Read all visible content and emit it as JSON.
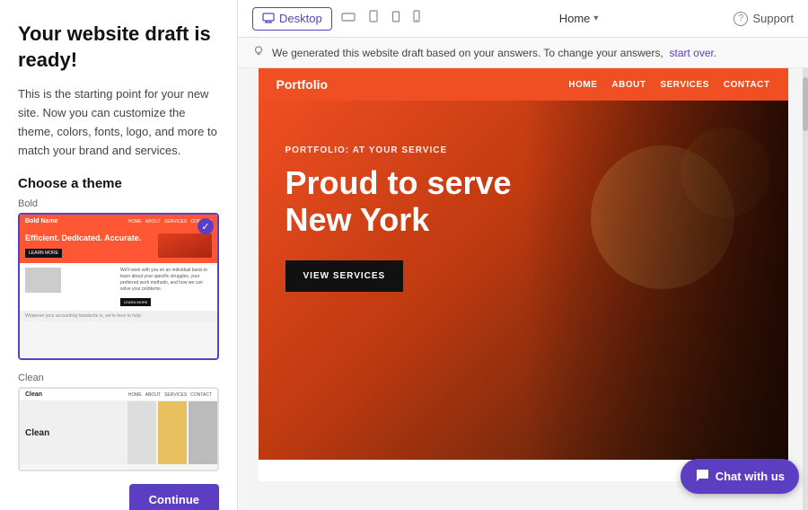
{
  "leftPanel": {
    "heading": "Your website draft is ready!",
    "description": "This is the starting point for your new site. Now you can customize the theme, colors, fonts, logo, and more to match your brand and services.",
    "chooseThemeLabel": "Choose a theme",
    "themes": [
      {
        "id": "bold",
        "label": "Bold",
        "selected": true,
        "heroText": "Efficient. Dedicated. Accurate.",
        "ctaText": "LEARN MORE",
        "sectionText": "We'll work with you on an individual basis to learn about your specific struggles, your preferred work methods, and how we can solve your problems.",
        "footerText": "Whatever your accounting headache is, we're here to help."
      },
      {
        "id": "clean",
        "label": "Clean",
        "selected": false
      }
    ],
    "continueButtonLabel": "Continue"
  },
  "topBar": {
    "deviceTabs": [
      {
        "id": "desktop",
        "label": "Desktop",
        "icon": "🖥",
        "active": true
      },
      {
        "id": "tablet-landscape",
        "label": "",
        "icon": "⬜",
        "active": false
      },
      {
        "id": "tablet-portrait",
        "label": "",
        "icon": "▭",
        "active": false
      },
      {
        "id": "tablet-small",
        "label": "",
        "icon": "▭",
        "active": false
      },
      {
        "id": "mobile",
        "label": "",
        "icon": "📱",
        "active": false
      }
    ],
    "pageSelector": {
      "label": "Home",
      "arrow": "▾"
    },
    "supportButton": "Support"
  },
  "noticeBar": {
    "text": "We generated this website draft based on your answers. To change your answers,",
    "linkText": "start over",
    "suffix": "."
  },
  "preview": {
    "nav": {
      "logo": "Portfolio",
      "links": [
        "HOME",
        "ABOUT",
        "SERVICES",
        "CONTACT"
      ]
    },
    "hero": {
      "subtitle": "PORTFOLIO: AT YOUR SERVICE",
      "title": "Proud to serve New York",
      "ctaText": "VIEW SERVICES"
    }
  },
  "chatButton": {
    "label": "Chat with us",
    "icon": "💬"
  }
}
